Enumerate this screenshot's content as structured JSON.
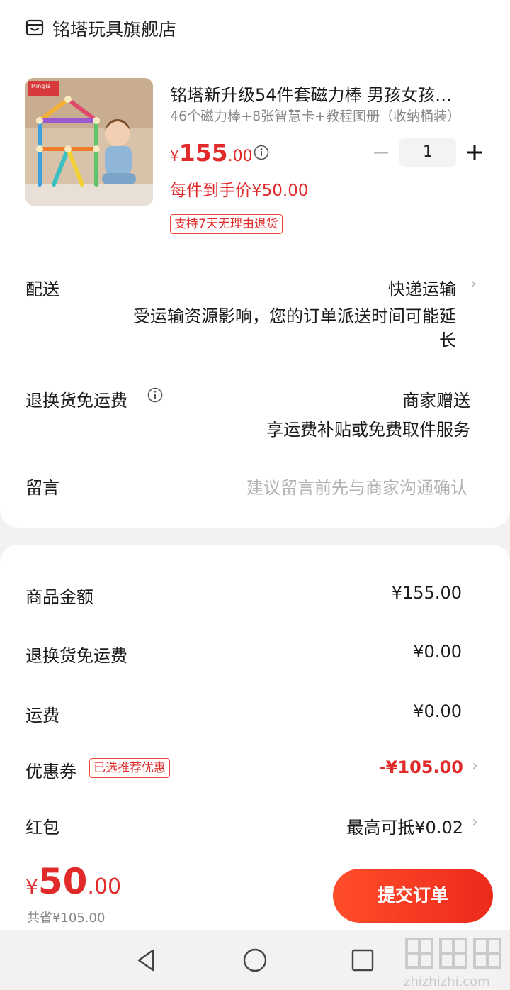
{
  "store": {
    "name": "铭塔玩具旗舰店",
    "icon": "store-icon"
  },
  "product": {
    "title": "铭塔新升级54件套磁力棒 男孩女孩…",
    "spec": "46个磁力棒+8张智慧卡+教程图册（收纳桶装）",
    "price_currency": "¥",
    "price_int": "155",
    "price_dec": ".00",
    "quantity": "1",
    "unit_price": "每件到手价¥50.00",
    "return_tag": "支持7天无理由退货",
    "thumb_brand": "MingTa"
  },
  "delivery": {
    "label": "配送",
    "value": "快递运输",
    "note_line1": "受运输资源影响，您的订单派送时间可能延",
    "note_line2": "长"
  },
  "return_shipping": {
    "label": "退换货免运费",
    "value": "商家赠送",
    "desc": "享运费补贴或免费取件服务"
  },
  "message": {
    "label": "留言",
    "placeholder": "建议留言前先与商家沟通确认"
  },
  "summary": [
    {
      "label": "商品金额",
      "value": "¥155.00"
    },
    {
      "label": "退换货免运费",
      "value": "¥0.00"
    },
    {
      "label": "运费",
      "value": "¥0.00"
    },
    {
      "label": "优惠券",
      "badge": "已选推荐优惠",
      "value": "-¥105.00"
    },
    {
      "label": "红包",
      "value": "最高可抵¥0.02"
    }
  ],
  "bottom": {
    "total_currency": "¥",
    "total_int": "50",
    "total_dec": ".00",
    "saved": "共省¥105.00",
    "submit_label": "提交订单"
  },
  "watermark": {
    "text": "zhizhizhi.com"
  },
  "colors": {
    "accent": "#e12b2b",
    "button": "#f0321f",
    "muted": "#888888"
  }
}
